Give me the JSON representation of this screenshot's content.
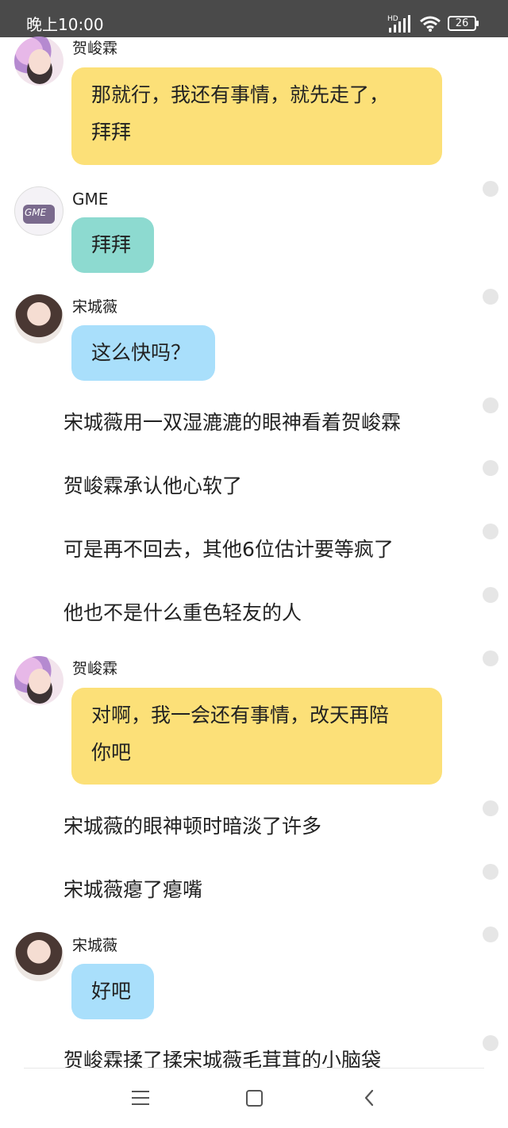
{
  "status_bar": {
    "time": "晚上10:00",
    "network_label": "HD",
    "battery": "26"
  },
  "messages": [
    {
      "type": "chat",
      "sender": "贺峻霖",
      "bubble_color": "#fce078",
      "lines": [
        "那就行，我还有事情，就先走了，",
        "拜拜"
      ]
    },
    {
      "type": "chat",
      "sender": "GME",
      "bubble_color": "#8ddad0",
      "lines": [
        "拜拜"
      ]
    },
    {
      "type": "chat",
      "sender": "宋城薇",
      "bubble_color": "#a9dffb",
      "lines": [
        "这么快吗？"
      ]
    },
    {
      "type": "narration",
      "text": "宋城薇用一双湿漉漉的眼神看着贺峻霖"
    },
    {
      "type": "narration",
      "text": "贺峻霖承认他心软了"
    },
    {
      "type": "narration",
      "text": "可是再不回去，其他6位估计要等疯了"
    },
    {
      "type": "narration",
      "text": "他也不是什么重色轻友的人"
    },
    {
      "type": "chat",
      "sender": "贺峻霖",
      "bubble_color": "#fce078",
      "lines": [
        "对啊，我一会还有事情，改天再陪",
        "你吧"
      ]
    },
    {
      "type": "narration",
      "text": "宋城薇的眼神顿时暗淡了许多"
    },
    {
      "type": "narration",
      "text": "宋城薇瘪了瘪嘴"
    },
    {
      "type": "chat",
      "sender": "宋城薇",
      "bubble_color": "#a9dffb",
      "lines": [
        "好吧"
      ]
    },
    {
      "type": "narration",
      "text": "贺峻霖揉了揉宋城薇毛茸茸的小脑袋"
    }
  ],
  "nav_bar": {
    "icons": [
      "menu-icon",
      "home-icon",
      "back-icon"
    ]
  }
}
